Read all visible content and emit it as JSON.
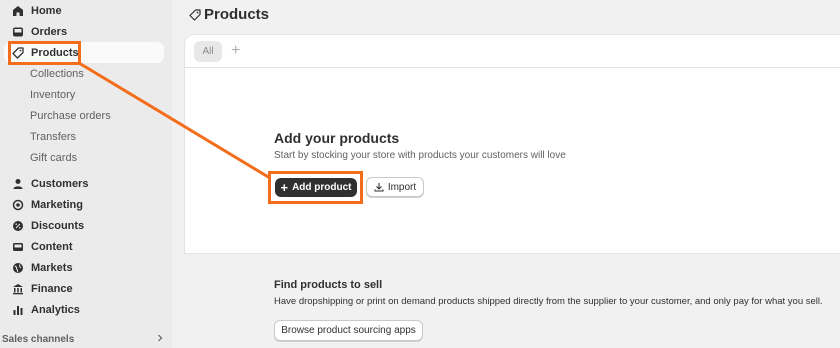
{
  "sidebar": {
    "items": [
      {
        "label": "Home",
        "icon": "home-icon"
      },
      {
        "label": "Orders",
        "icon": "inbox-icon"
      },
      {
        "label": "Products",
        "icon": "tag-icon",
        "active": true
      }
    ],
    "sub_items": [
      "Collections",
      "Inventory",
      "Purchase orders",
      "Transfers",
      "Gift cards"
    ],
    "items2": [
      {
        "label": "Customers",
        "icon": "person-icon"
      },
      {
        "label": "Marketing",
        "icon": "target-icon"
      },
      {
        "label": "Discounts",
        "icon": "discount-icon"
      },
      {
        "label": "Content",
        "icon": "image-icon"
      },
      {
        "label": "Markets",
        "icon": "globe-icon"
      },
      {
        "label": "Finance",
        "icon": "bank-icon"
      },
      {
        "label": "Analytics",
        "icon": "bar-chart-icon"
      }
    ],
    "sales_channels": "Sales channels"
  },
  "header": {
    "title": "Products"
  },
  "tabs": {
    "all": "All",
    "add": "+"
  },
  "empty_state": {
    "title": "Add your products",
    "description": "Start by stocking your store with products your customers will love",
    "add_button": "Add product",
    "import_button": "Import"
  },
  "find": {
    "title": "Find products to sell",
    "description": "Have dropshipping or print on demand products shipped directly from the supplier to your customer, and only pay for what you sell.",
    "browse_button": "Browse product sourcing apps"
  },
  "colors": {
    "highlight": "#f46d1a",
    "primary_button": "#303030"
  }
}
